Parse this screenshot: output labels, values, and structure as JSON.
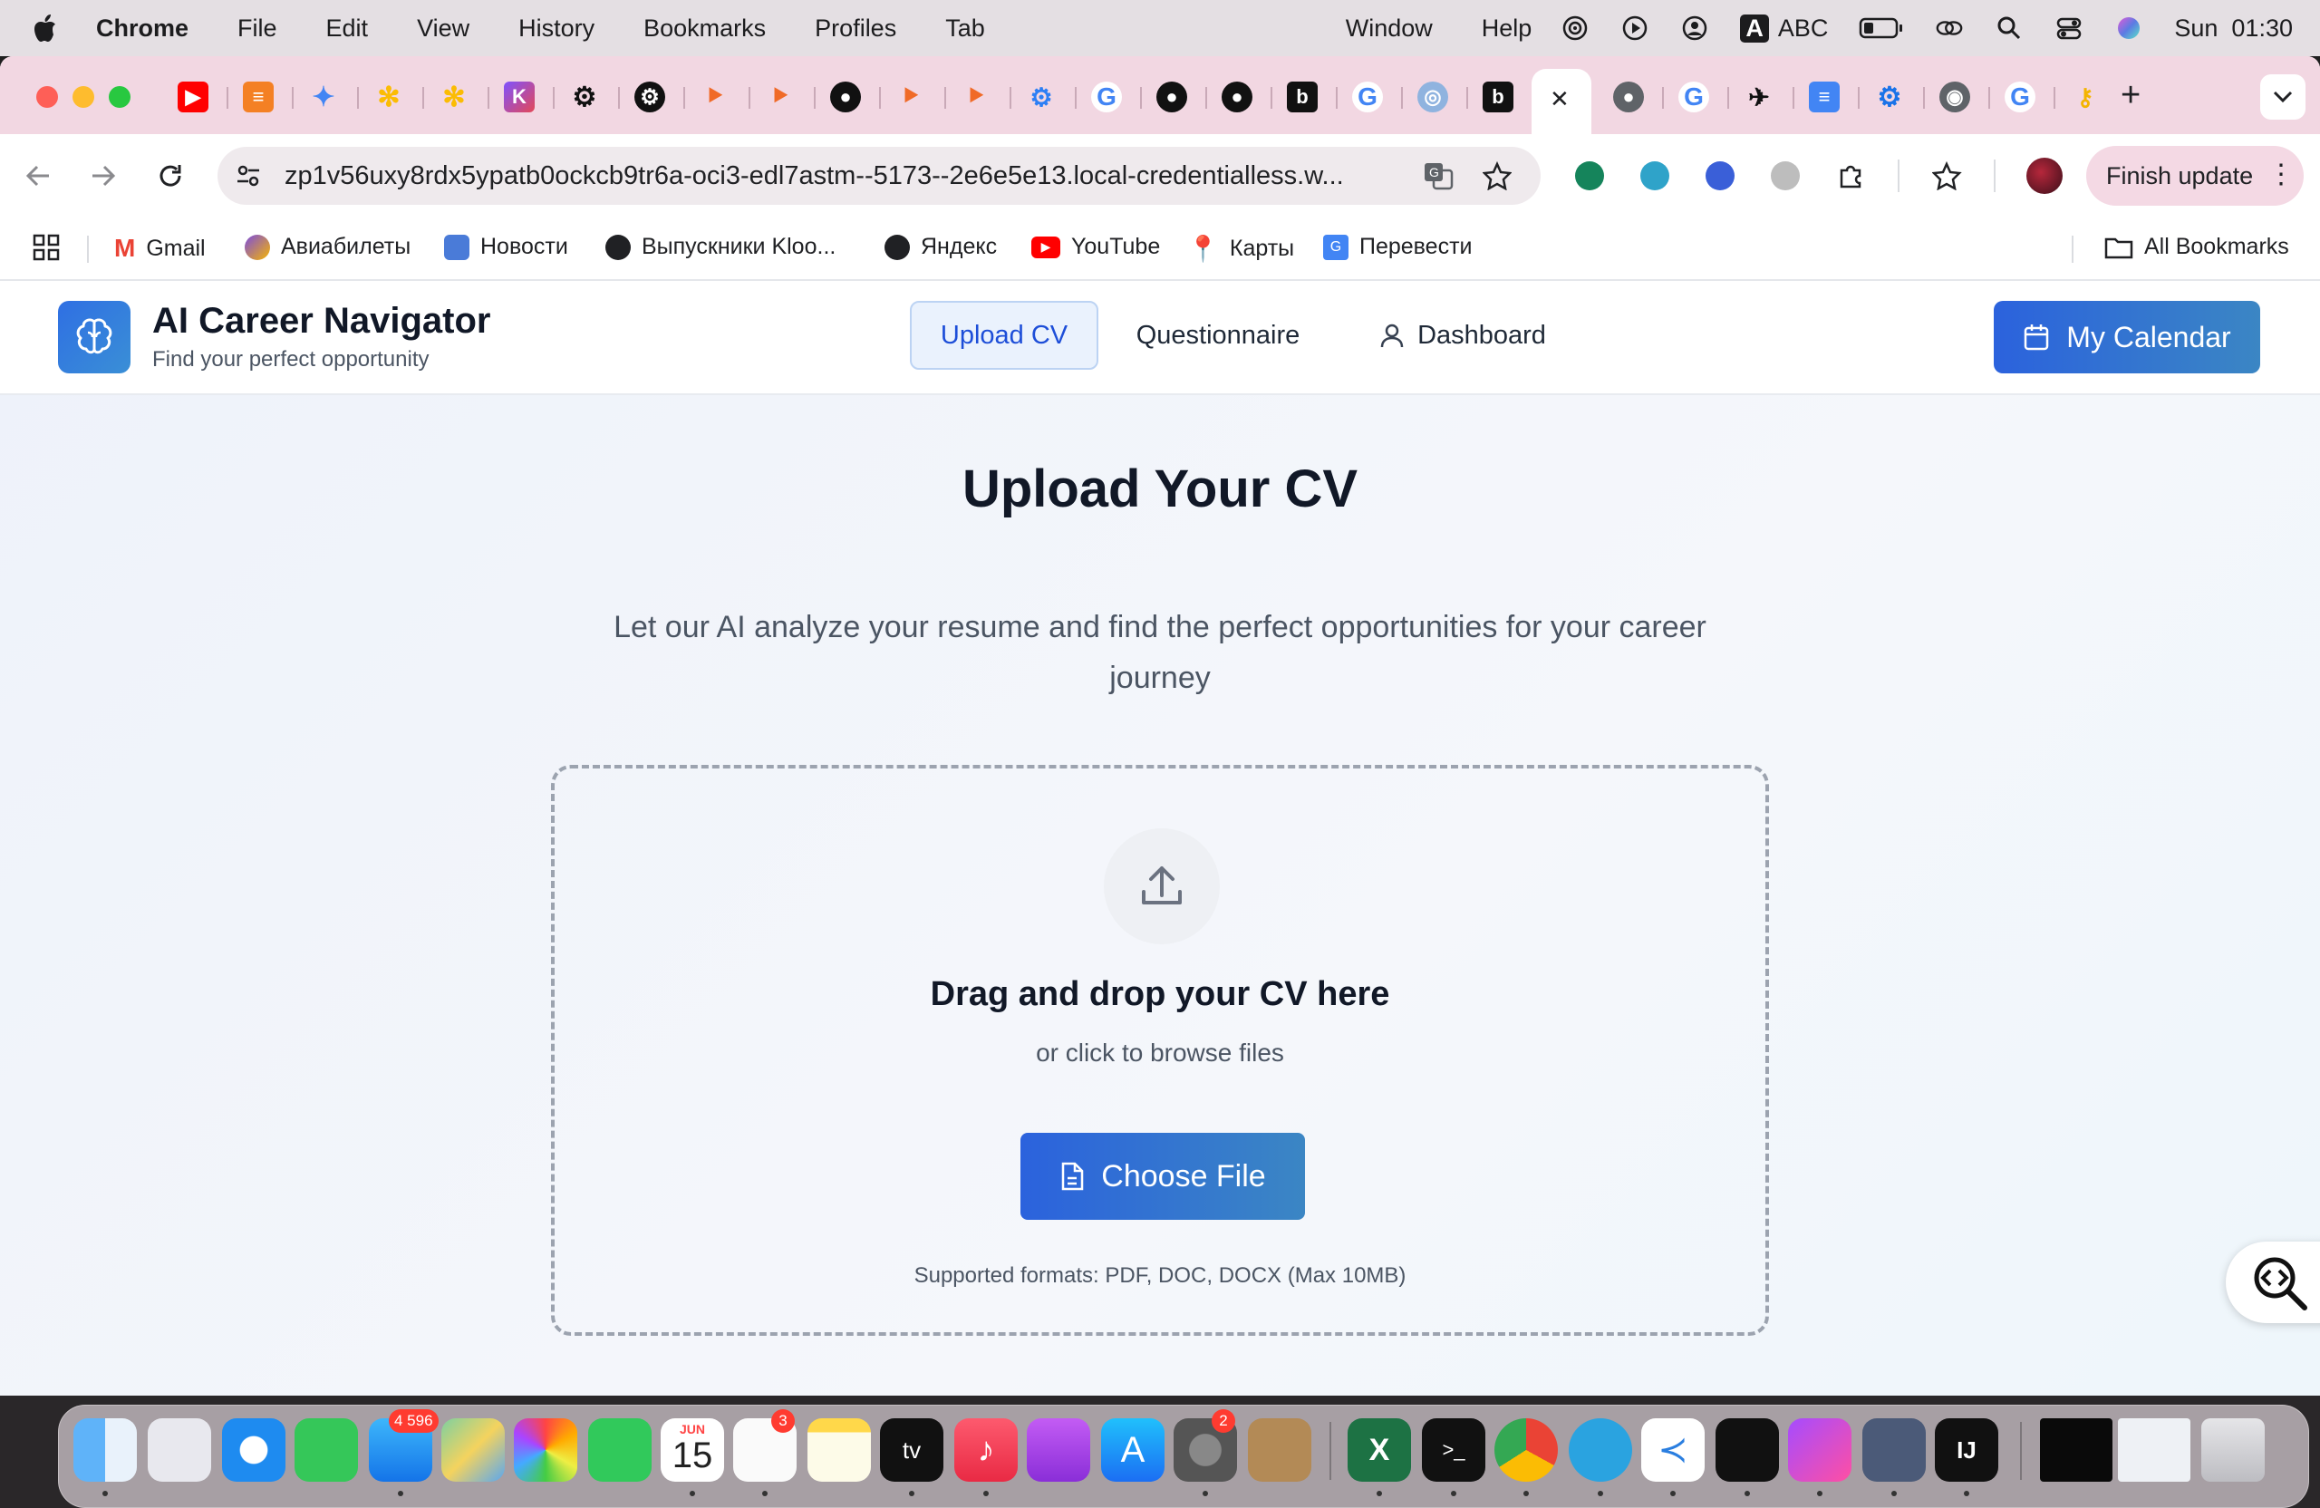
{
  "menubar": {
    "app": "Chrome",
    "items": [
      "File",
      "Edit",
      "View",
      "History",
      "Bookmarks",
      "Profiles",
      "Tab",
      "Window",
      "Help"
    ],
    "input_source": "ABC",
    "clock": "Sun  01:30"
  },
  "browser": {
    "url": "zp1v56uxy8rdx5ypatb0ockcb9tr6a-oci3-edl7astm--5173--2e6e5e13.local-credentialless.w...",
    "finish_update": "Finish update",
    "bookmarks": [
      "Gmail",
      "Авиабилеты",
      "Новости",
      "Выпускники Kloo...",
      "Яндекс",
      "YouTube",
      "Карты",
      "Перевести"
    ],
    "all_bookmarks": "All Bookmarks",
    "active_tab_close": "✕",
    "new_tab": "+"
  },
  "app": {
    "brand_title": "AI Career Navigator",
    "brand_subtitle": "Find your perfect opportunity",
    "nav": {
      "upload": "Upload CV",
      "questionnaire": "Questionnaire",
      "dashboard": "Dashboard"
    },
    "calendar_button": "My Calendar",
    "hero_title": "Upload Your CV",
    "hero_subtitle": "Let our AI analyze your resume and find the perfect opportunities for your career journey",
    "drop_title": "Drag and drop your CV here",
    "drop_subtitle": "or click to browse files",
    "choose_button": "Choose File",
    "formats": "Supported formats: PDF, DOC, DOCX (Max 10MB)"
  },
  "dock": {
    "mail_badge": "4 596",
    "calendar_month": "JUN",
    "calendar_day": "15",
    "reminders_badge": "3",
    "settings_badge": "2"
  },
  "colors": {
    "accent": "#2b62dd",
    "accent2": "#3b86c4",
    "tabstrip": "#f2d7e2"
  }
}
